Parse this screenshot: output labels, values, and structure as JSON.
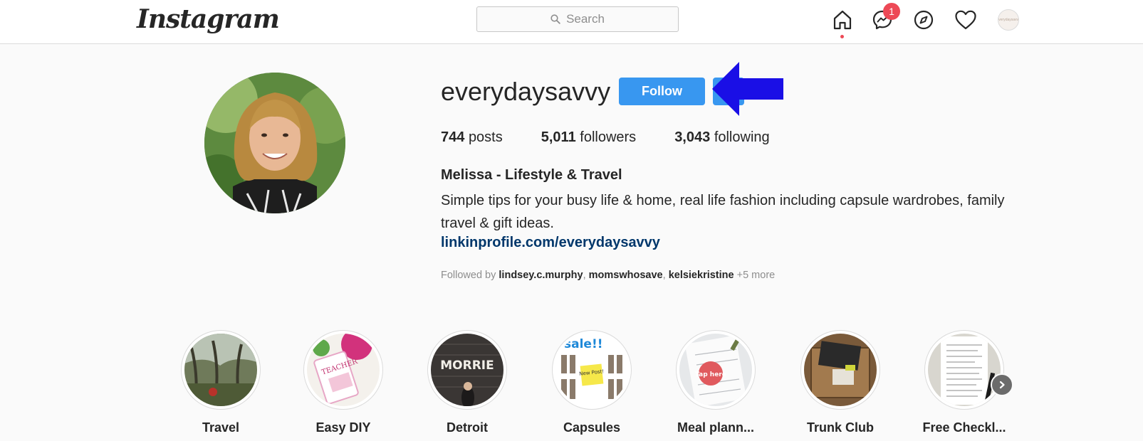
{
  "nav": {
    "logo": "Instagram",
    "search_placeholder": "Search",
    "messages_badge": "1",
    "avatar_text": "everydaysavvy"
  },
  "profile": {
    "username": "everydaysavvy",
    "follow_label": "Follow",
    "stats": {
      "posts_count": "744",
      "posts_label": "posts",
      "followers_count": "5,011",
      "followers_label": "followers",
      "following_count": "3,043",
      "following_label": "following"
    },
    "bio": {
      "name": "Melissa - Lifestyle & Travel",
      "text": "Simple tips for your busy life & home, real life fashion including capsule wardrobes, family travel & gift ideas.",
      "link": "linkinprofile.com/everydaysavvy"
    },
    "followed_by": {
      "prefix": "Followed by",
      "accounts": [
        "lindsey.c.murphy",
        "momswhosave",
        "kelsiekristine"
      ],
      "more": "+5 more"
    }
  },
  "highlights": [
    {
      "label": "Travel"
    },
    {
      "label": "Easy DIY"
    },
    {
      "label": "Detroit"
    },
    {
      "label": "Capsules"
    },
    {
      "label": "Meal plann..."
    },
    {
      "label": "Trunk Club"
    },
    {
      "label": "Free Checkl..."
    }
  ],
  "highlight_thumb_text": {
    "diy": "TEACHER",
    "detroit": "MORRIE",
    "capsules_top": "sale!!",
    "capsules_note": "New Post!",
    "meal": "Tap here"
  },
  "colors": {
    "follow_blue": "#3897f0",
    "badge_red": "#ed4956",
    "link_blue": "#00376b",
    "annotation_arrow": "#1a0fe6"
  }
}
